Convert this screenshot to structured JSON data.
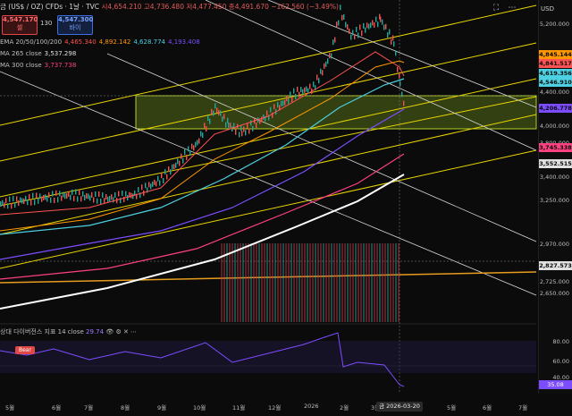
{
  "header": {
    "symbol": "금 (US$ / OZ) CFDs · 1날 · TVC",
    "ohlc": "시4,654.210  고4,736.480  저4,477.450  종4,491.670  −162.560 (−3.49%)"
  },
  "trade": {
    "sell_price": "4,547.170",
    "sell_label": "셀",
    "buy_price": "4,547.300",
    "buy_label": "바이",
    "spread": "130"
  },
  "indicators": [
    {
      "label": "EMA 20/50/100/200",
      "values": [
        {
          "text": "4,465.340",
          "color": "#ff5252"
        },
        {
          "text": "4,892.142",
          "color": "#ff9800"
        },
        {
          "text": "4,628.774",
          "color": "#4dd0e1"
        },
        {
          "text": "4,193.408",
          "color": "#7c4dff"
        }
      ]
    },
    {
      "label": "MA 265 close",
      "values": [
        {
          "text": "3,537.298",
          "color": "#e0e0e0"
        }
      ]
    },
    {
      "label": "MA 300 close",
      "values": [
        {
          "text": "3,737.738",
          "color": "#ff4081"
        }
      ]
    }
  ],
  "axis": {
    "currency": "USD",
    "y_ticks": [
      {
        "label": "5,200.000",
        "y": 5200
      },
      {
        "label": "4,800.000",
        "y": 4800
      },
      {
        "label": "4,400.000",
        "y": 4400
      },
      {
        "label": "4,000.000",
        "y": 4000
      },
      {
        "label": "3,800.000",
        "y": 3800
      },
      {
        "label": "3,400.000",
        "y": 3400
      },
      {
        "label": "3,250.000",
        "y": 3250
      },
      {
        "label": "2,970.000",
        "y": 2970
      },
      {
        "label": "2,725.000",
        "y": 2725
      },
      {
        "label": "2,650.000",
        "y": 2650
      }
    ],
    "price_tags": [
      {
        "label": "4,845.144",
        "color": "#ff9800",
        "value": 4845
      },
      {
        "label": "4,841.517",
        "color": "#ff5252",
        "value": 4841
      },
      {
        "label": "4,619.356",
        "color": "#4dd0e1",
        "value": 4619
      },
      {
        "label": "4,546.910",
        "color": "#4dd0e1",
        "value": 4547
      },
      {
        "label": "4,206.778",
        "color": "#7c4dff",
        "value": 4207
      },
      {
        "label": "3,745.338",
        "color": "#ff4081",
        "value": 3745
      },
      {
        "label": "3,552.515",
        "color": "#e0e0e0",
        "value": 3553
      },
      {
        "label": "2,827.573",
        "color": "#e0e0e0",
        "value": 2827
      }
    ],
    "x_ticks": [
      "5월",
      "6월",
      "7월",
      "8월",
      "9월",
      "10월",
      "11월",
      "12월",
      "2026",
      "2월",
      "3월",
      "5월",
      "6월",
      "7월"
    ],
    "crosshair_date": "금 2026-03-20"
  },
  "rsi": {
    "title": "상대 다이버전스 지표 14 close",
    "value": "29.74",
    "label": "Bear",
    "ticks": [
      "80.00",
      "60.00",
      "40.00"
    ],
    "current": "35.08"
  },
  "toolbar": {
    "fullscreen_icon": "⛶",
    "more_icon": "⋯"
  }
}
